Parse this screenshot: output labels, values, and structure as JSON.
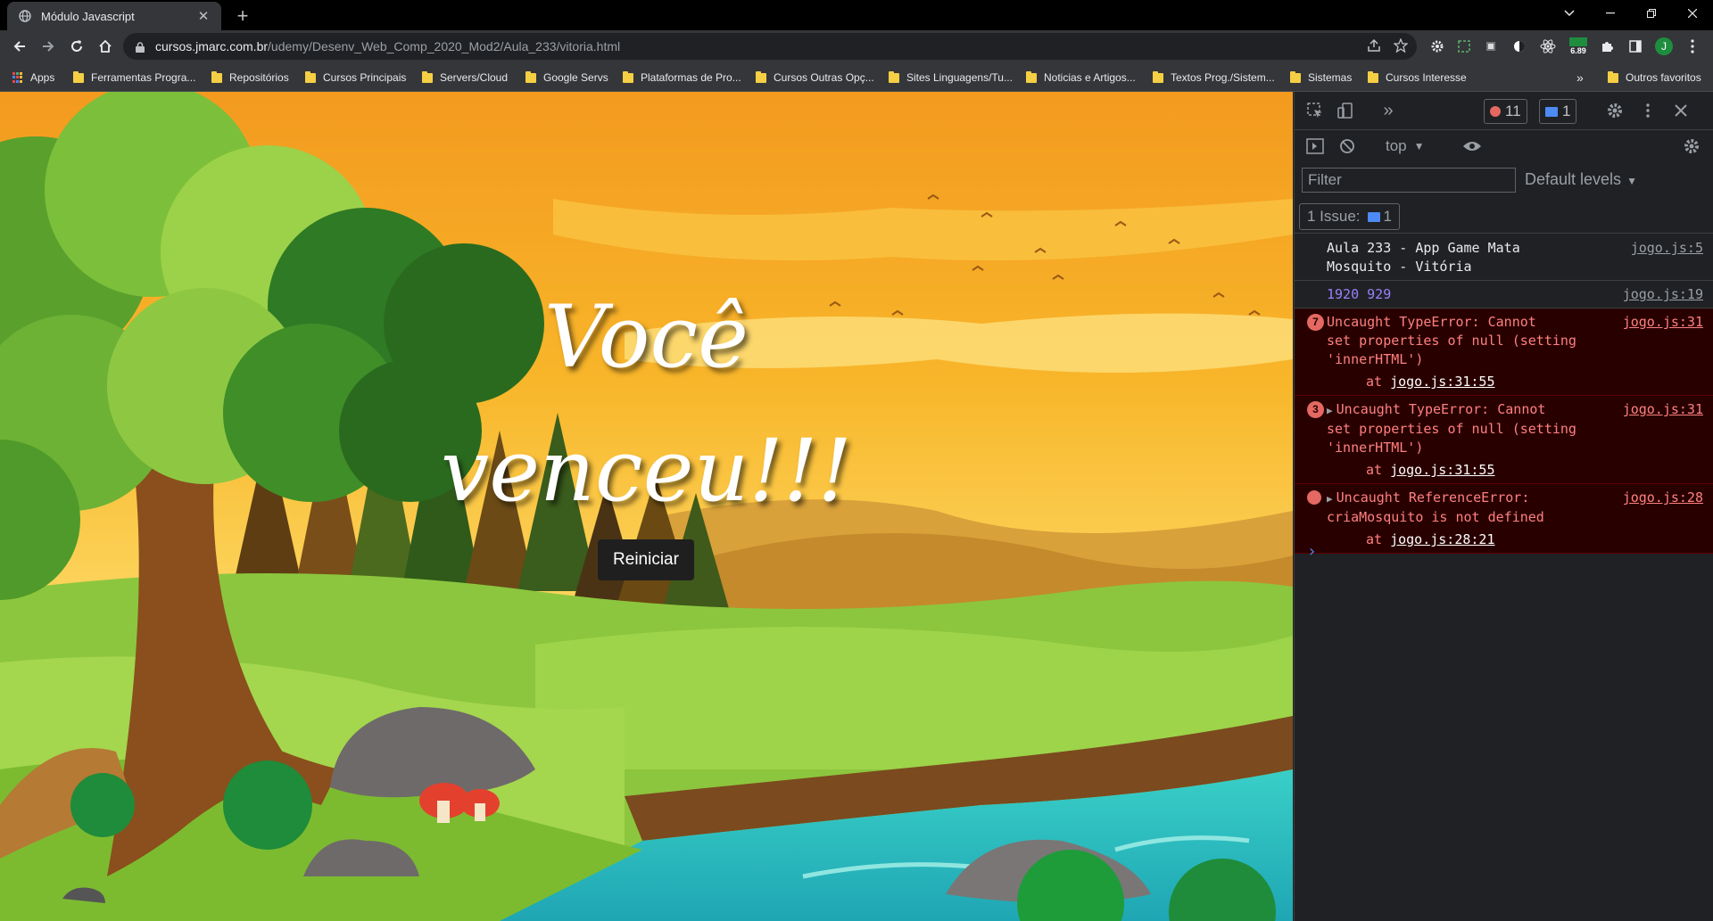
{
  "tab": {
    "title": "Módulo Javascript",
    "close": "✕"
  },
  "toolbar": {
    "url_host": "cursos.jmarc.com.br",
    "url_path": "/udemy/Desenv_Web_Comp_2020_Mod2/Aula_233/vitoria.html",
    "ext_badge": "6.89",
    "profile_initial": "J"
  },
  "bookmarks": {
    "apps": "Apps",
    "items": [
      "Ferramentas Progra...",
      "Repositórios",
      "Cursos Principais",
      "Servers/Cloud",
      "Google Servs",
      "Plataformas de Pro...",
      "Cursos Outras Opç...",
      "Sites Linguagens/Tu...",
      "Noticias e Artigos...",
      "Textos Prog./Sistem...",
      "Sistemas",
      "Cursos Interesse"
    ],
    "overflow": "»",
    "other": "Outros favoritos"
  },
  "page": {
    "title_line1": "Você",
    "title_line2": "venceu!!!",
    "restart_label": "Reiniciar"
  },
  "devtools": {
    "more_tabs": "»",
    "error_count": "11",
    "message_count": "1",
    "context": "top",
    "filter_placeholder": "Filter",
    "levels": "Default levels",
    "issues_label": "1 Issue:",
    "issues_count": "1",
    "messages": [
      {
        "text": "Aula 233 - App Game Mata\nMosquito - Vitória",
        "source": "jogo.js:5"
      },
      {
        "text": "1920 929",
        "source": "jogo.js:19"
      },
      {
        "count": "7",
        "text": "Uncaught TypeError: Cannot\nset properties of null (setting\n'innerHTML')",
        "stack_prefix": "at ",
        "stack_link": "jogo.js:31:55",
        "source": "jogo.js:31"
      },
      {
        "count": "3",
        "text": "Uncaught TypeError: Cannot\nset properties of null (setting\n'innerHTML')",
        "stack_prefix": "at ",
        "stack_link": "jogo.js:31:55",
        "source": "jogo.js:31"
      },
      {
        "text": "Uncaught ReferenceError:\ncriaMosquito is not defined",
        "stack_prefix": "at ",
        "stack_link": "jogo.js:28:21",
        "source": "jogo.js:28"
      }
    ],
    "prompt": "›"
  },
  "colors": {
    "error_bg": "#290000",
    "error_text": "#ff8080",
    "accent_blue": "#4e8af3",
    "sky": "#f6a321",
    "grass": "#8cc63e",
    "river": "#2ec4c0"
  }
}
